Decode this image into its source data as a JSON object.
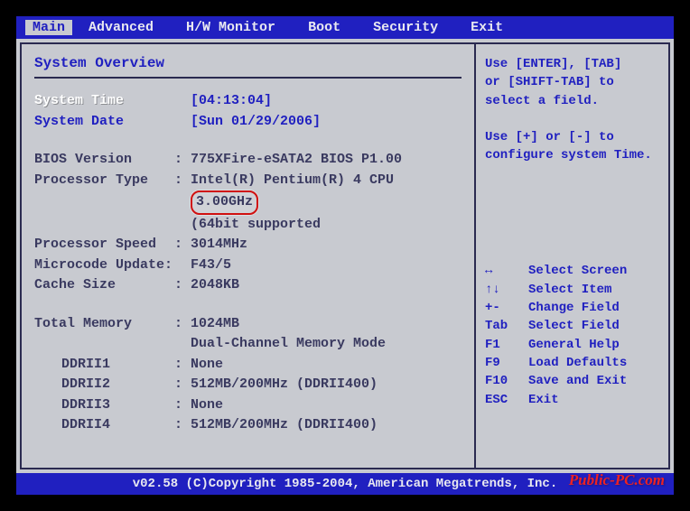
{
  "menubar": {
    "items": [
      "Main",
      "Advanced",
      "H/W Monitor",
      "Boot",
      "Security",
      "Exit"
    ],
    "active": 0
  },
  "section_title": "System Overview",
  "time": {
    "label": "System Time",
    "value": "[04:13:04]"
  },
  "date": {
    "label": "System Date",
    "value": "[Sun 01/29/2006]"
  },
  "bios_version": {
    "label": "BIOS Version",
    "value": "775XFire-eSATA2 BIOS P1.00"
  },
  "processor_type": {
    "label": "Processor Type",
    "value_pre": "Intel(R) Pentium(R) 4 CPU ",
    "value_highlight": "3.00GHz",
    "value_line2": "(64bit supported"
  },
  "processor_speed": {
    "label": "Processor Speed",
    "value": "3014MHz"
  },
  "microcode_update": {
    "label": "Microcode Update",
    "colon_inline": ":",
    "value": "F43/5"
  },
  "cache_size": {
    "label": "Cache Size",
    "value": "2048KB"
  },
  "total_memory": {
    "label": "Total Memory",
    "value": "1024MB",
    "value_line2": "Dual-Channel Memory Mode"
  },
  "slots": [
    {
      "label": "DDRII1",
      "value": "None"
    },
    {
      "label": "DDRII2",
      "value": "512MB/200MHz (DDRII400)"
    },
    {
      "label": "DDRII3",
      "value": "None"
    },
    {
      "label": "DDRII4",
      "value": "512MB/200MHz (DDRII400)"
    }
  ],
  "help": {
    "intro_l1": "Use [ENTER], [TAB]",
    "intro_l2": "or [SHIFT-TAB] to",
    "intro_l3": "select a field.",
    "intro_l4": "Use [+] or [-] to",
    "intro_l5": "configure system Time.",
    "keys": [
      {
        "key": "↔",
        "desc": "Select Screen"
      },
      {
        "key": "↑↓",
        "desc": "Select Item"
      },
      {
        "key": "+-",
        "desc": "Change Field"
      },
      {
        "key": "Tab",
        "desc": "Select Field"
      },
      {
        "key": "F1",
        "desc": "General Help"
      },
      {
        "key": "F9",
        "desc": "Load Defaults"
      },
      {
        "key": "F10",
        "desc": "Save and Exit"
      },
      {
        "key": "ESC",
        "desc": "Exit"
      }
    ]
  },
  "footer": "v02.58 (C)Copyright 1985-2004, American Megatrends, Inc.",
  "watermark": "Public-PC.com"
}
